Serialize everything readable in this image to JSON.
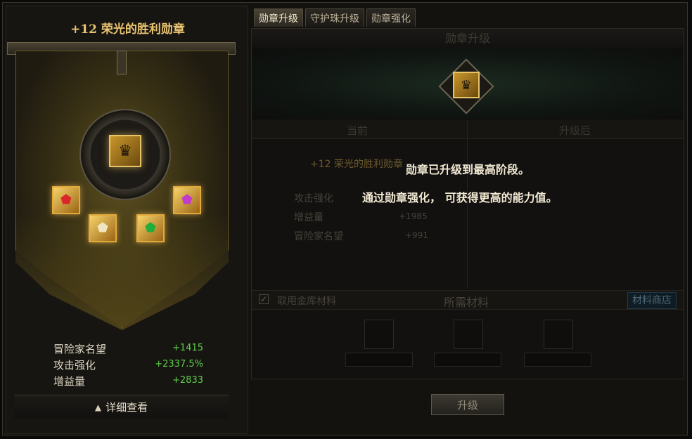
{
  "medal": {
    "title": "+12 荣光的胜利勋章",
    "icon": "medal-icon",
    "gems": [
      {
        "name": "red-gem-icon",
        "color": "#d8262a"
      },
      {
        "name": "white-gem-icon",
        "color": "#f0e5c0"
      },
      {
        "name": "green-gem-icon",
        "color": "#1fae3c"
      },
      {
        "name": "purple-gem-icon",
        "color": "#c23cc9"
      }
    ],
    "stats": [
      {
        "label": "冒险家名望",
        "value": "+1415"
      },
      {
        "label": "攻击强化",
        "value": "+2337.5%"
      },
      {
        "label": "增益量",
        "value": "+2833"
      }
    ],
    "detail_label": "详细查看"
  },
  "tabs": [
    {
      "label": "勋章升级",
      "active": true
    },
    {
      "label": "守护珠升级",
      "active": false
    },
    {
      "label": "勋章强化",
      "active": false
    }
  ],
  "upgrade": {
    "section_title": "勋章升级",
    "col_current": "当前",
    "col_after": "升级后",
    "current_name": "+12 荣光的胜利勋章",
    "current_stats": [
      {
        "label": "攻击强化",
        "value": ""
      },
      {
        "label": "增益量",
        "value": "+1985"
      },
      {
        "label": "冒险家名望",
        "value": "+991"
      }
    ],
    "message_line1": "勋章已升级到最高阶段。",
    "message_line2": "通过勋章强化， 可获得更高的能力值。",
    "use_vault_label": "取用金库材料",
    "required_materials": "所需材料",
    "material_shop": "材料商店",
    "upgrade_button": "升级"
  },
  "colors": {
    "gold_title": "#e8c371",
    "stat_green": "#5fcf4c"
  }
}
